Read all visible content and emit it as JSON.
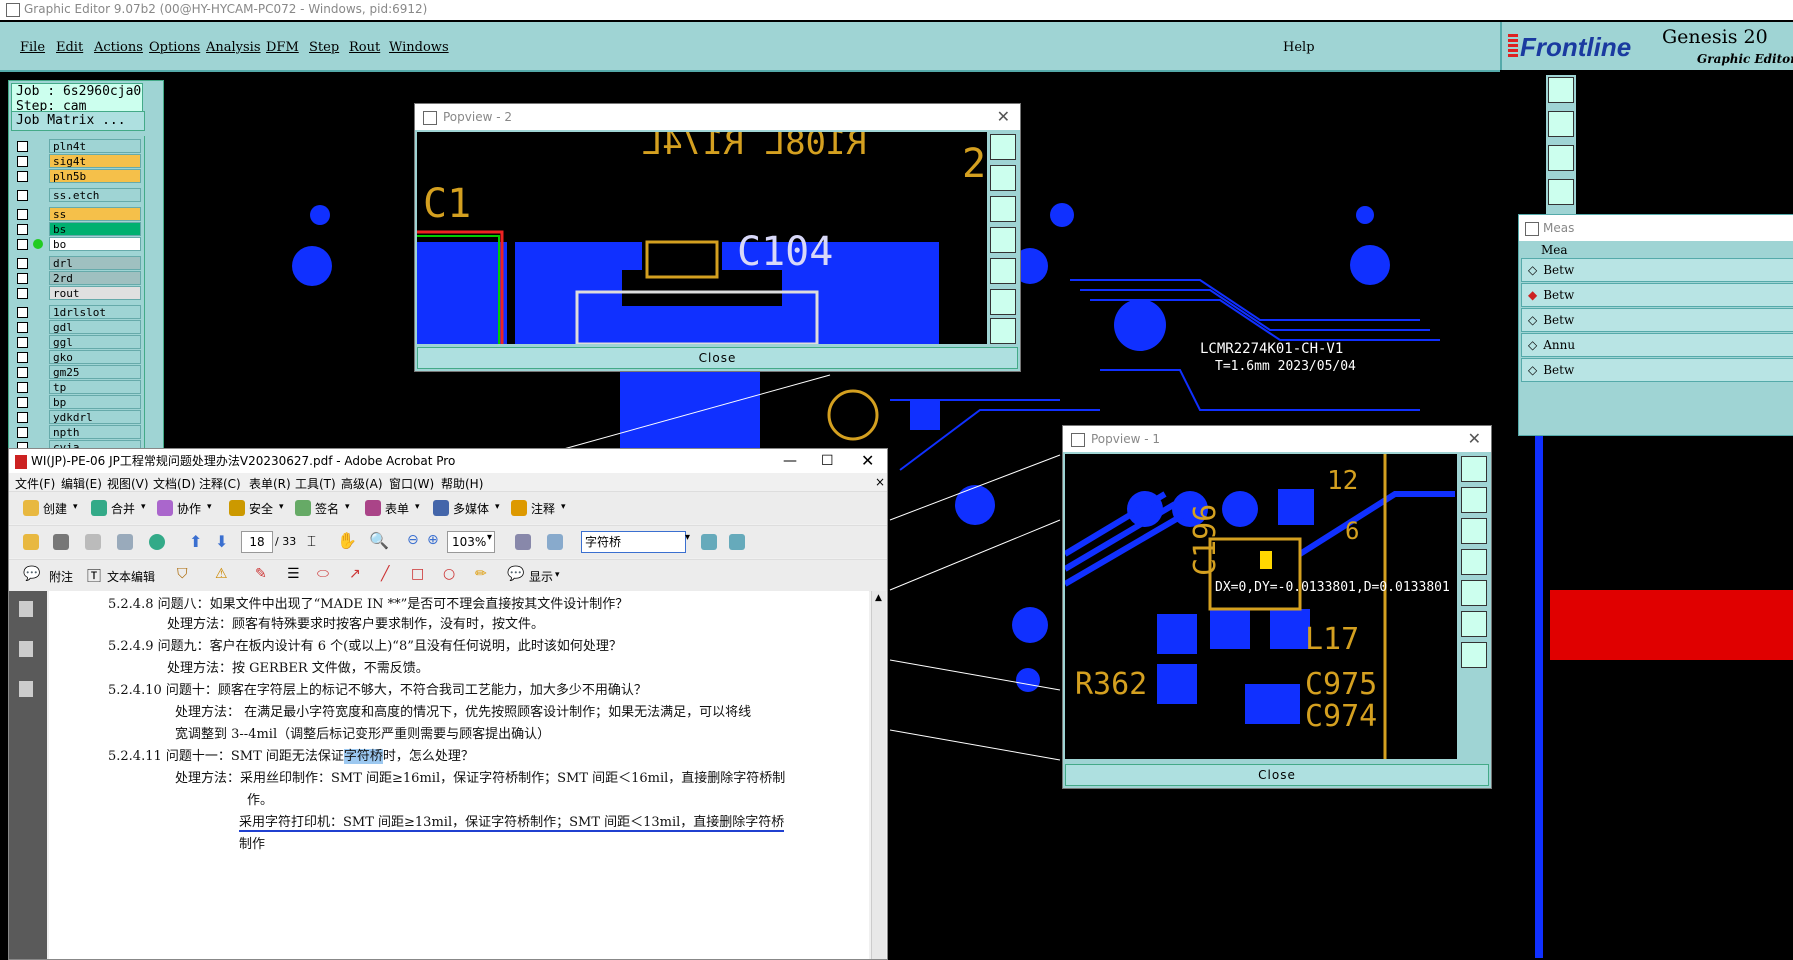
{
  "app": {
    "window_title": "Graphic Editor 9.07b2 (00@HY-HYCAM-PC072 - Windows, pid:6912)",
    "menus": [
      "File",
      "Edit",
      "Actions",
      "Options",
      "Analysis",
      "DFM",
      "Step",
      "Rout",
      "Windows"
    ],
    "help": "Help",
    "brand_logo": "Frontline",
    "brand_title": "Genesis 20",
    "brand_sub": "Graphic Editor"
  },
  "left_panel": {
    "job": "Job : 6s2960cja0",
    "step": "Step: cam",
    "job_matrix": "Job Matrix ...",
    "layers": [
      {
        "name": "pln4t",
        "color": "#9fd4d4"
      },
      {
        "name": "sig4t",
        "color": "#f5c04a"
      },
      {
        "name": "pln5b",
        "color": "#f5c04a"
      },
      {
        "name": "ss.etch",
        "color": "#9fd4d4"
      },
      {
        "name": "ss",
        "color": "#f5c04a"
      },
      {
        "name": "bs",
        "color": "#00b070"
      },
      {
        "name": "bo",
        "color": "#ffffff"
      },
      {
        "name": "drl",
        "color": "#9fc0c0"
      },
      {
        "name": "2rd",
        "color": "#9fc0c0"
      },
      {
        "name": "rout",
        "color": "#e0e0e0"
      },
      {
        "name": "1drlslot",
        "color": "#9fd4d4"
      },
      {
        "name": "gdl",
        "color": "#9fd4d4"
      },
      {
        "name": "ggl",
        "color": "#9fd4d4"
      },
      {
        "name": "gko",
        "color": "#9fd4d4"
      },
      {
        "name": "gm25",
        "color": "#9fd4d4"
      },
      {
        "name": "tp",
        "color": "#9fd4d4"
      },
      {
        "name": "bp",
        "color": "#9fd4d4"
      },
      {
        "name": "ydkdrl",
        "color": "#9fd4d4"
      },
      {
        "name": "npth",
        "color": "#9fd4d4"
      },
      {
        "name": "cvia",
        "color": "#9fd4d4"
      }
    ]
  },
  "pcb_labels": {
    "board_id": "LCMR2274K01-CH-V1",
    "board_thk": "T=1.6mm   2023/05/04"
  },
  "popview2": {
    "title": "Popview - 2",
    "close": "Close",
    "labels": {
      "c1": "C1",
      "c104": "C104",
      "two": "2",
      "r": "R108L R174L"
    }
  },
  "popview1": {
    "title": "Popview - 1",
    "close": "Close",
    "measure": "DX=0,DY=-0.0133801,D=0.0133801",
    "labels": {
      "n12": "12",
      "n6": "6",
      "c196": "C196",
      "l17": "L17",
      "c975": "C975",
      "c974": "C974",
      "r362": "R362"
    }
  },
  "measure_panel": {
    "title": "Meas",
    "header": "Mea",
    "rows": [
      "Betw",
      "Betw",
      "Betw",
      "Annu",
      "Betw"
    ]
  },
  "acrobat": {
    "title": "WI(JP)-PE-06 JP工程常规问题处理办法V20230627.pdf - Adobe Acrobat Pro",
    "menus": [
      "文件(F)",
      "编辑(E)",
      "视图(V)",
      "文档(D)",
      "注释(C)",
      "表单(R)",
      "工具(T)",
      "高级(A)",
      "窗口(W)",
      "帮助(H)"
    ],
    "toolbar1": [
      "创建",
      "合并",
      "协作",
      "安全",
      "签名",
      "表单",
      "多媒体",
      "注释"
    ],
    "page_current": "18",
    "page_total": "/ 33",
    "zoom": "103%",
    "search": "字符桥",
    "toolbar3": [
      "附注",
      "文本编辑",
      "显示"
    ],
    "doc_lines": [
      "5.2.4.8  问题八：如果文件中出现了“MADE IN **”是否可不理会直接按其文件设计制作？",
      "处理方法：顾客有特殊要求时按客户要求制作，没有时，按文件。",
      "5.2.4.9  问题九：客户在板内设计有 6 个(或以上)“8”且没有任何说明，此时该如何处理？",
      "处理方法：按 GERBER 文件做，不需反馈。",
      "5.2.4.10  问题十：顾客在字符层上的标记不够大，不符合我司工艺能力，加大多少不用确认？",
      "处理方法：  在满足最小字符宽度和高度的情况下，优先按照顾客设计制作；如果无法满足，可以将线",
      "宽调整到 3--4mil（调整后标记变形严重则需要与顾客提出确认）",
      "5.2.4.11  问题十一：SMT 间距无法保证",
      "字符桥",
      "时，怎么处理？",
      "处理方法：采用丝印制作：SMT 间距≥16mil，保证字符桥制作；SMT 间距＜16mil，直接删除字符桥制",
      "作。",
      "采用字符打印机：SMT 间距≥13mil，保证字符桥制作；SMT 间距＜13mil，直接删除字符桥",
      "制作"
    ]
  }
}
